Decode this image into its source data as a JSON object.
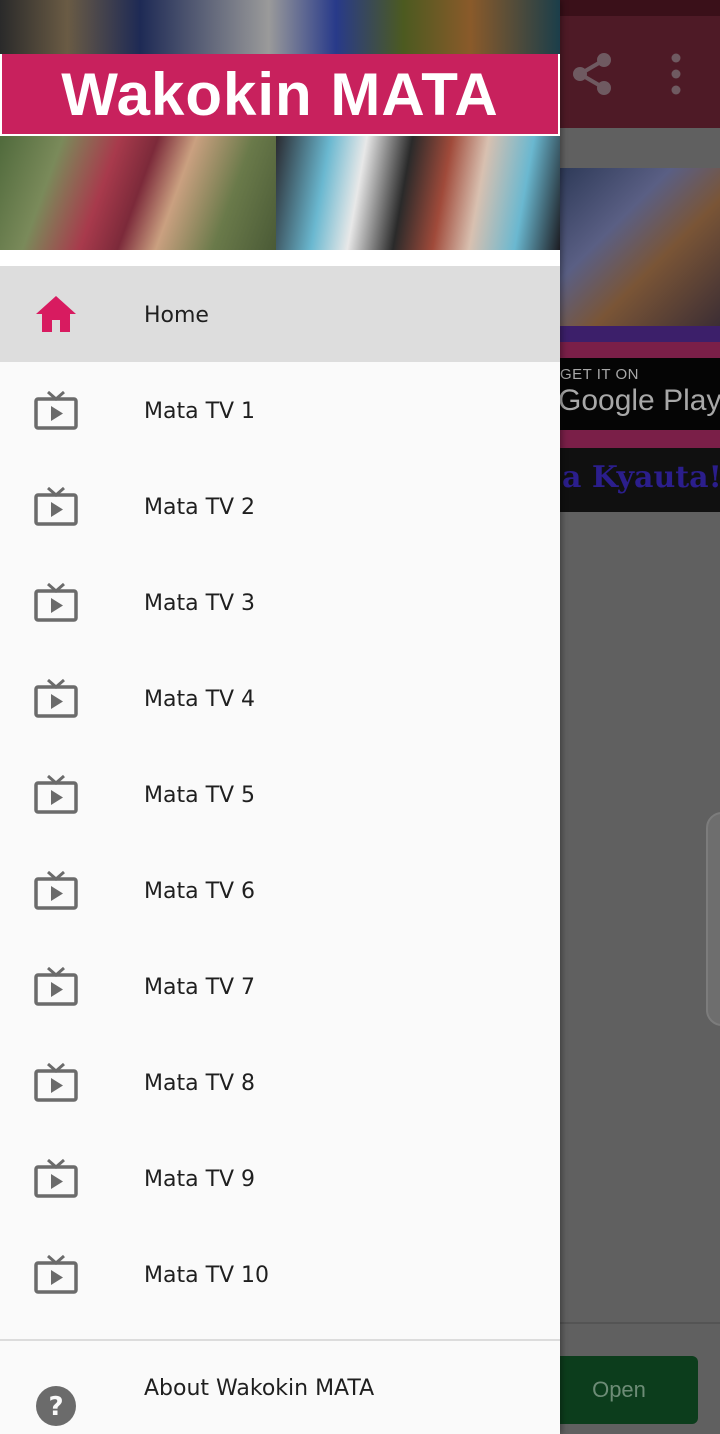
{
  "background_app": {
    "actions": [
      {
        "name": "share",
        "icon": "share-icon"
      },
      {
        "name": "more",
        "icon": "more-vert-icon"
      }
    ],
    "gplay_small": "GET IT ON",
    "gplay_big": "Google Play",
    "promo_text": "a Kyauta!",
    "open_button": "Open"
  },
  "drawer": {
    "title": "Wakokin MATA",
    "accent_color": "#c8215d",
    "menu": [
      {
        "label": "Home",
        "icon": "home-icon",
        "selected": true
      },
      {
        "label": "Mata TV 1",
        "icon": "tv-icon"
      },
      {
        "label": "Mata TV 2",
        "icon": "tv-icon"
      },
      {
        "label": "Mata TV 3",
        "icon": "tv-icon"
      },
      {
        "label": "Mata TV 4",
        "icon": "tv-icon"
      },
      {
        "label": "Mata TV 5",
        "icon": "tv-icon"
      },
      {
        "label": "Mata TV 6",
        "icon": "tv-icon"
      },
      {
        "label": "Mata TV 7",
        "icon": "tv-icon"
      },
      {
        "label": "Mata TV 8",
        "icon": "tv-icon"
      },
      {
        "label": "Mata TV 9",
        "icon": "tv-icon"
      },
      {
        "label": "Mata TV 10",
        "icon": "tv-icon"
      }
    ],
    "about": {
      "label": "About Wakokin MATA",
      "icon": "help-icon"
    }
  }
}
